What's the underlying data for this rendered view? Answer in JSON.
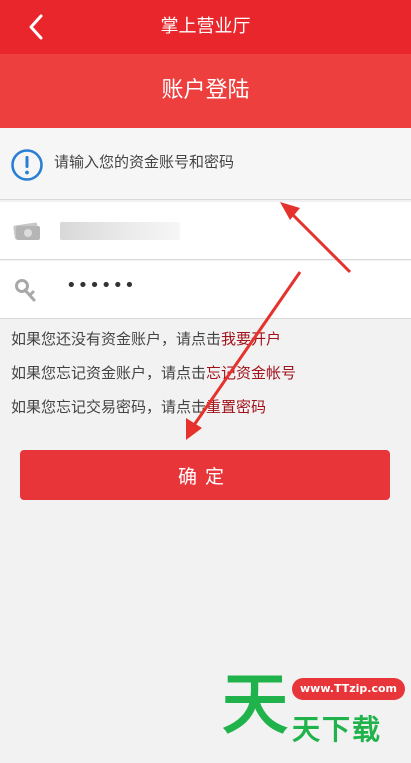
{
  "nav": {
    "title": "掌上营业厅"
  },
  "header": {
    "title": "账户登陆"
  },
  "hint": {
    "text": "请输入您的资金账号和密码"
  },
  "form": {
    "password_value": "••••••"
  },
  "links": [
    {
      "prefix": "如果您还没有资金账户，请点击",
      "action": "我要开户"
    },
    {
      "prefix": "如果您忘记资金账户，请点击",
      "action": "忘记资金帐号"
    },
    {
      "prefix": "如果您忘记交易密码，请点击",
      "action": "重置密码"
    }
  ],
  "confirm": {
    "label": "确定"
  },
  "watermark": {
    "glyph": "天",
    "url": "www.TTzip.com",
    "text": "天下载"
  },
  "colors": {
    "nav": "#e8262b",
    "header": "#ee3f3f",
    "button": "#e8353a",
    "link": "#a0121b",
    "arrow": "#e5322d"
  },
  "icons": {
    "back": "chevron-left-icon",
    "info": "info-icon",
    "account": "money-icon",
    "password": "key-icon"
  }
}
